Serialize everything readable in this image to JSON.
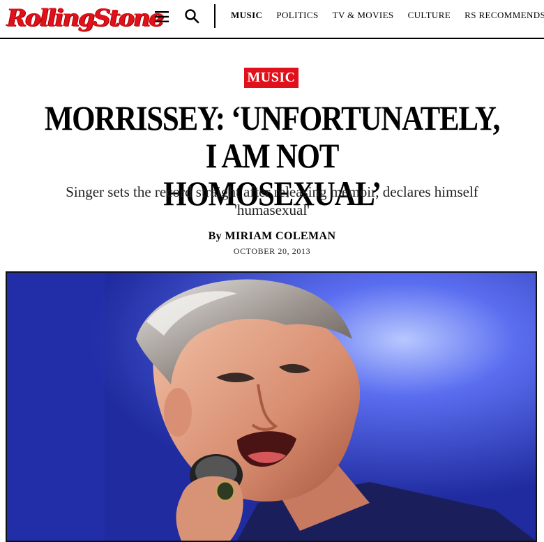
{
  "header": {
    "logo_text": "RollingStone",
    "nav": [
      {
        "label": "MUSIC",
        "active": true
      },
      {
        "label": "POLITICS",
        "active": false
      },
      {
        "label": "TV & MOVIES",
        "active": false
      },
      {
        "label": "CULTURE",
        "active": false
      },
      {
        "label": "RS RECOMMENDS",
        "active": false
      }
    ],
    "icons": [
      "menu-icon",
      "search-icon"
    ]
  },
  "article": {
    "section": "MUSIC",
    "headline_line1": "MORRISSEY: ‘UNFORTUNATELY, I AM NOT",
    "headline_line2": "HOMOSEXUAL’",
    "subhead": "Singer sets the record straight after releasing memoir, declares himself 'humasexual'",
    "byline_prefix": "By",
    "author": "MIRIAM COLEMAN",
    "date": "OCTOBER 20, 2013"
  },
  "colors": {
    "brand_red": "#e0111b",
    "text": "#000000",
    "hero_blue": "#2a3ac8"
  }
}
